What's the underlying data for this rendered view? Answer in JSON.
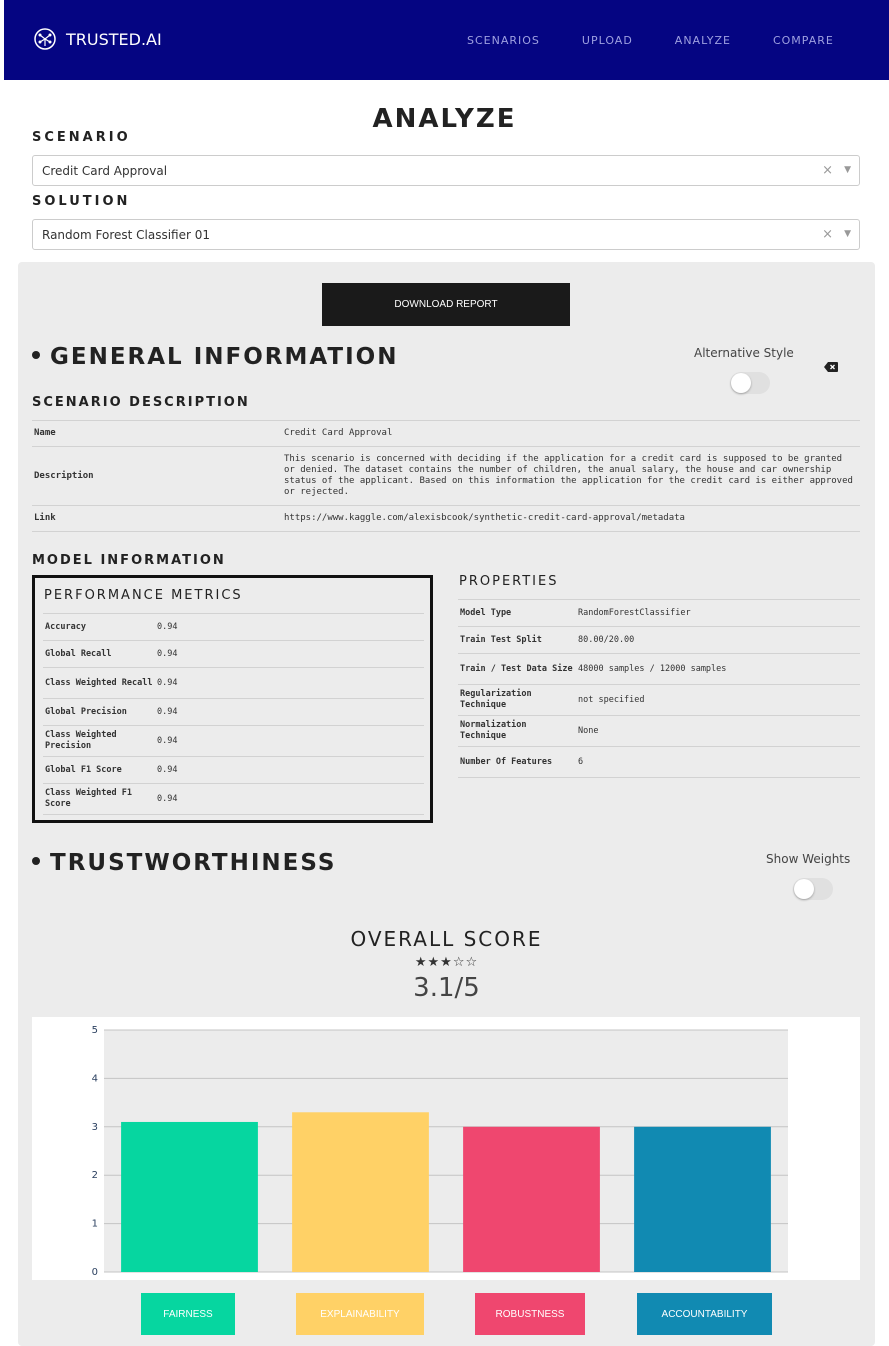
{
  "navbar": {
    "brand": "TRUSTED.AI",
    "links": [
      "SCENARIOS",
      "UPLOAD",
      "ANALYZE",
      "COMPARE"
    ]
  },
  "page": {
    "title": "ANALYZE"
  },
  "scenario": {
    "label": "SCENARIO",
    "value": "Credit Card Approval",
    "clear": "×",
    "arrow": "▼"
  },
  "solution": {
    "label": "SOLUTION",
    "value": "Random Forest Classifier 01",
    "clear": "×",
    "arrow": "▼"
  },
  "download": {
    "label": "DOWNLOAD REPORT"
  },
  "general": {
    "title": "GENERAL INFORMATION",
    "alt_style_label": "Alternative Style",
    "scenario_desc_title": "SCENARIO DESCRIPTION",
    "rows": [
      {
        "key": "Name",
        "value": "Credit Card Approval"
      },
      {
        "key": "Description",
        "value": "This scenario is concerned with deciding if the application for a credit card is supposed to be granted or denied. The dataset contains the number of children, the anual salary, the house and car ownership status of the applicant. Based on this information the application for the credit card is either approved or rejected."
      },
      {
        "key": "Link",
        "value": "https://www.kaggle.com/alexisbcook/synthetic-credit-card-approval/metadata"
      }
    ],
    "model_info_title": "MODEL INFORMATION"
  },
  "performance": {
    "title": "PERFORMANCE METRICS",
    "rows": [
      {
        "key": "Accuracy",
        "value": "0.94"
      },
      {
        "key": "Global Recall",
        "value": "0.94"
      },
      {
        "key": "Class Weighted Recall",
        "value": "0.94"
      },
      {
        "key": "Global Precision",
        "value": "0.94"
      },
      {
        "key": "Class Weighted Precision",
        "value": "0.94"
      },
      {
        "key": "Global F1 Score",
        "value": "0.94"
      },
      {
        "key": "Class Weighted F1 Score",
        "value": "0.94"
      }
    ]
  },
  "properties": {
    "title": "PROPERTIES",
    "rows": [
      {
        "key": "Model Type",
        "value": "RandomForestClassifier"
      },
      {
        "key": "Train Test Split",
        "value": "80.00/20.00"
      },
      {
        "key": "Train / Test Data Size",
        "value": "48000 samples / 12000 samples"
      },
      {
        "key": "Regularization Technique",
        "value": "not specified"
      },
      {
        "key": "Normalization Technique",
        "value": "None"
      },
      {
        "key": "Number Of Features",
        "value": "6"
      }
    ]
  },
  "trust": {
    "title": "TRUSTWORTHINESS",
    "show_weights_label": "Show Weights",
    "overall_title": "OVERALL SCORE",
    "stars": "★★★☆☆",
    "rating": 3,
    "rating_max": 5,
    "score": "3.1/5"
  },
  "colors": {
    "navbar": "#050582",
    "fairness": "#06d6a0",
    "explainability": "#ffd166",
    "robustness": "#ef476f",
    "accountability": "#118ab2"
  },
  "chart_data": {
    "type": "bar",
    "categories": [
      "FAIRNESS",
      "EXPLAINABILITY",
      "ROBUSTNESS",
      "ACCOUNTABILITY"
    ],
    "values": [
      3.1,
      3.3,
      3.0,
      3.0
    ],
    "colors": [
      "#06d6a0",
      "#ffd166",
      "#ef476f",
      "#118ab2"
    ],
    "ylim": [
      0,
      5
    ],
    "yticks": [
      "0",
      "1",
      "2",
      "3",
      "4",
      "5"
    ],
    "grid": true,
    "legend": "bottom"
  }
}
